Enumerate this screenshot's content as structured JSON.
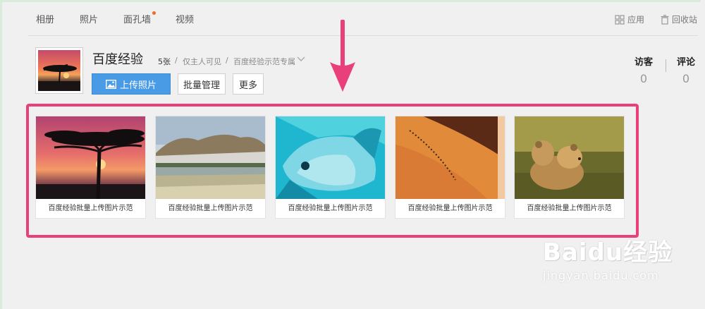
{
  "nav": {
    "tabs": [
      "相册",
      "照片",
      "面孔墙",
      "视频"
    ],
    "apps_label": "应用",
    "recycle_label": "回收站"
  },
  "album": {
    "title": "百度经验",
    "count": "5张",
    "separator": "/",
    "visibility": "仅主人可见",
    "category": "百度经验示范专属"
  },
  "actions": {
    "upload": "上传照片",
    "batch": "批量管理",
    "more": "更多"
  },
  "stats": {
    "visitors_label": "访客",
    "visitors": "0",
    "comments_label": "评论",
    "comments": "0"
  },
  "photos": [
    {
      "caption": "百度经验批量上传图片示范"
    },
    {
      "caption": "百度经验批量上传图片示范"
    },
    {
      "caption": "百度经验批量上传图片示范"
    },
    {
      "caption": "百度经验批量上传图片示范"
    },
    {
      "caption": "百度经验批量上传图片示范"
    }
  ],
  "watermark": {
    "logo": "Baidu经验",
    "url": "jingyan.baidu.com"
  },
  "colors": {
    "accent": "#4a9be6",
    "highlight": "#e93f7b",
    "badge": "#f06a2a"
  }
}
